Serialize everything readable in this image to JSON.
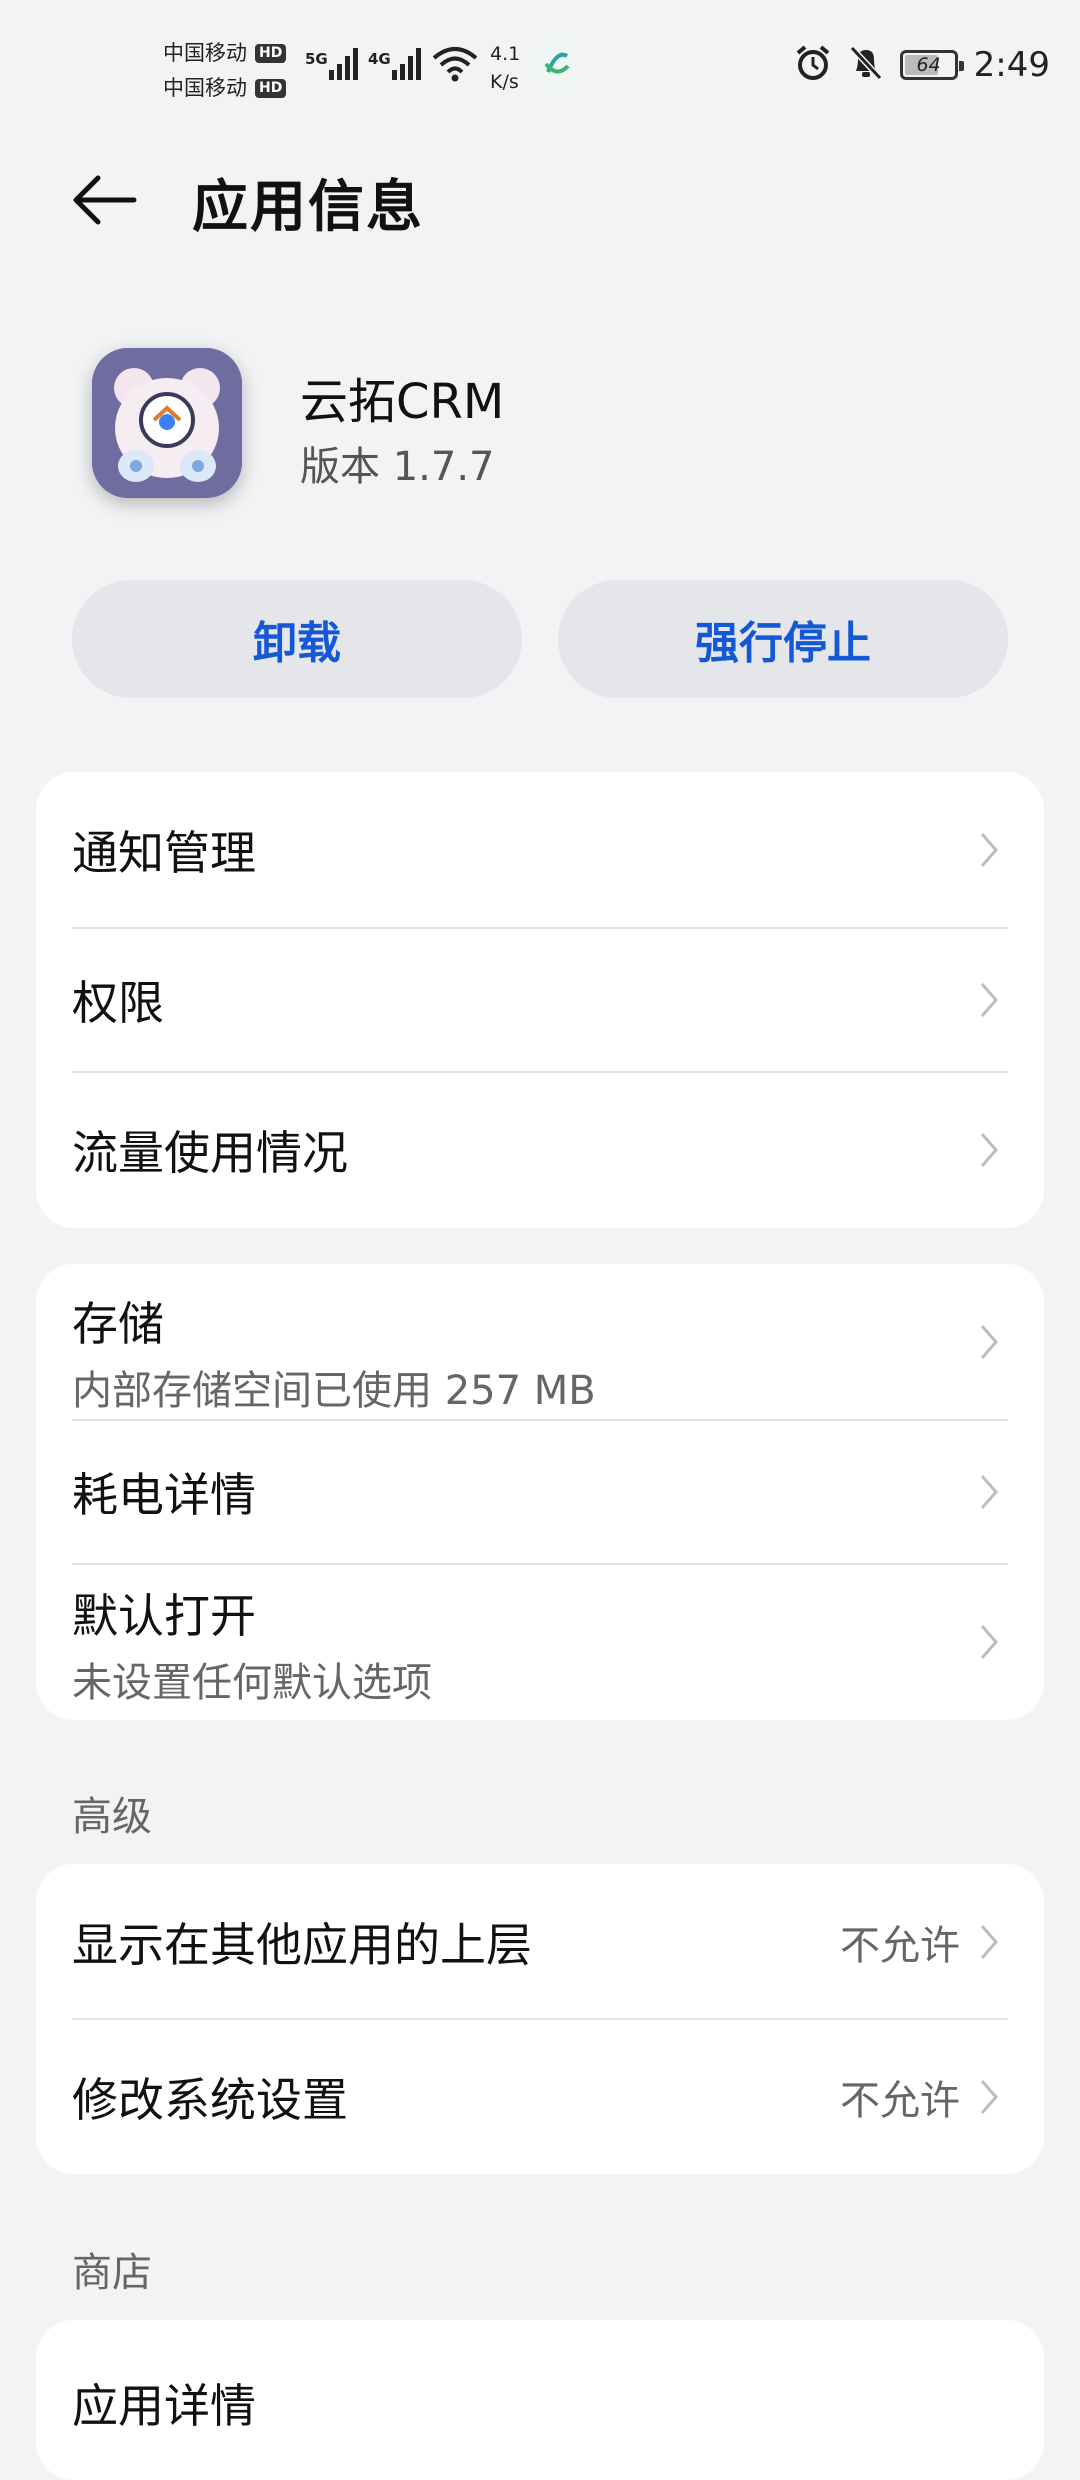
{
  "status_bar": {
    "carrier1": "中国移动",
    "carrier2": "中国移动",
    "hd_badge": "HD",
    "net1": "5G",
    "net2": "4G",
    "speed_value": "4.1",
    "speed_unit": "K/s",
    "battery": "64",
    "time": "2:49",
    "icons": [
      "alarm-icon",
      "mute-icon",
      "wifi-icon",
      "signal-icon",
      "carrier-logo-icon"
    ]
  },
  "header": {
    "title": "应用信息",
    "back_icon": "arrow-left-icon"
  },
  "app": {
    "name": "云拓CRM",
    "version": "版本 1.7.7"
  },
  "actions": {
    "uninstall": "卸载",
    "force_stop": "强行停止"
  },
  "section_general": {
    "items": [
      {
        "label": "通知管理"
      },
      {
        "label": "权限"
      },
      {
        "label": "流量使用情况"
      }
    ]
  },
  "section_storage": {
    "items": [
      {
        "label": "存储",
        "sub": "内部存储空间已使用 257 MB"
      },
      {
        "label": "耗电详情"
      },
      {
        "label": "默认打开",
        "sub": "未设置任何默认选项"
      }
    ]
  },
  "section_advanced": {
    "title": "高级",
    "items": [
      {
        "label": "显示在其他应用的上层",
        "value": "不允许"
      },
      {
        "label": "修改系统设置",
        "value": "不允许"
      }
    ]
  },
  "section_store": {
    "title": "商店",
    "items": [
      {
        "label": "应用详情"
      }
    ]
  },
  "colors": {
    "accent": "#1558d6",
    "background": "#f1f3f5",
    "card": "#ffffff"
  }
}
